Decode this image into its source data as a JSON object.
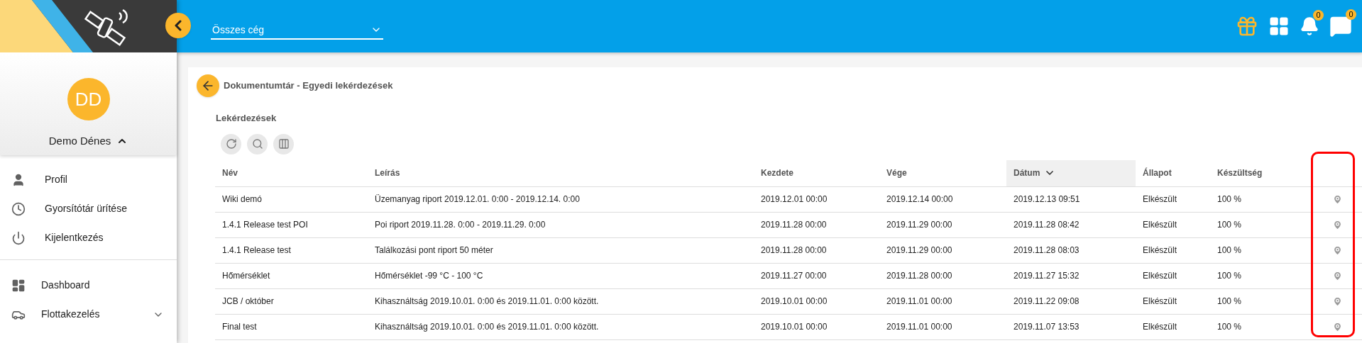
{
  "header": {
    "company_select": {
      "value": "Összes cég"
    },
    "notifications": {
      "count": "0"
    },
    "messages": {
      "count": "0"
    }
  },
  "sidebar": {
    "user": {
      "initials": "DD",
      "name": "Demo Dénes",
      "expanded": true
    },
    "account_items": [
      {
        "label": "Profil"
      },
      {
        "label": "Gyorsítótár ürítése"
      },
      {
        "label": "Kijelentkezés"
      }
    ],
    "nav_items": [
      {
        "label": "Dashboard",
        "expandable": false
      },
      {
        "label": "Flottakezelés",
        "expandable": true
      }
    ]
  },
  "page": {
    "title": "Dokumentumtár - Egyedi lekérdezések",
    "section": "Lekérdezések"
  },
  "table": {
    "columns": [
      {
        "label": "Név",
        "sorted": false
      },
      {
        "label": "Leírás",
        "sorted": false
      },
      {
        "label": "Kezdete",
        "sorted": false
      },
      {
        "label": "Vége",
        "sorted": false
      },
      {
        "label": "Dátum",
        "sorted": true
      },
      {
        "label": "Állapot",
        "sorted": false
      },
      {
        "label": "Készültség",
        "sorted": false
      }
    ],
    "rows": [
      [
        "Wiki demó",
        "Üzemanyag riport 2019.12.01. 0:00 - 2019.12.14. 0:00",
        "2019.12.01 00:00",
        "2019.12.14 00:00",
        "2019.12.13 09:51",
        "Elkészült",
        "100 %"
      ],
      [
        "1.4.1 Release test POI",
        "Poi riport 2019.11.28. 0:00 - 2019.11.29. 0:00",
        "2019.11.28 00:00",
        "2019.11.29 00:00",
        "2019.11.28 08:42",
        "Elkészült",
        "100 %"
      ],
      [
        "1.4.1 Release test",
        "Találkozási pont riport 50 méter",
        "2019.11.28 00:00",
        "2019.11.29 00:00",
        "2019.11.28 08:03",
        "Elkészült",
        "100 %"
      ],
      [
        "Hőmérséklet",
        "Hőmérséklet -99 °C - 100 °C",
        "2019.11.27 00:00",
        "2019.11.28 00:00",
        "2019.11.27 15:32",
        "Elkészült",
        "100 %"
      ],
      [
        "JCB / október",
        "Kihasználtság 2019.10.01. 0:00 és 2019.11.01. 0:00 között.",
        "2019.10.01 00:00",
        "2019.11.01 00:00",
        "2019.11.22 09:08",
        "Elkészült",
        "100 %"
      ],
      [
        "Final test",
        "Kihasználtság 2019.10.01. 0:00 és 2019.11.01. 0:00 között.",
        "2019.10.01 00:00",
        "2019.11.01 00:00",
        "2019.11.07 13:53",
        "Elkészült",
        "100 %"
      ]
    ]
  }
}
